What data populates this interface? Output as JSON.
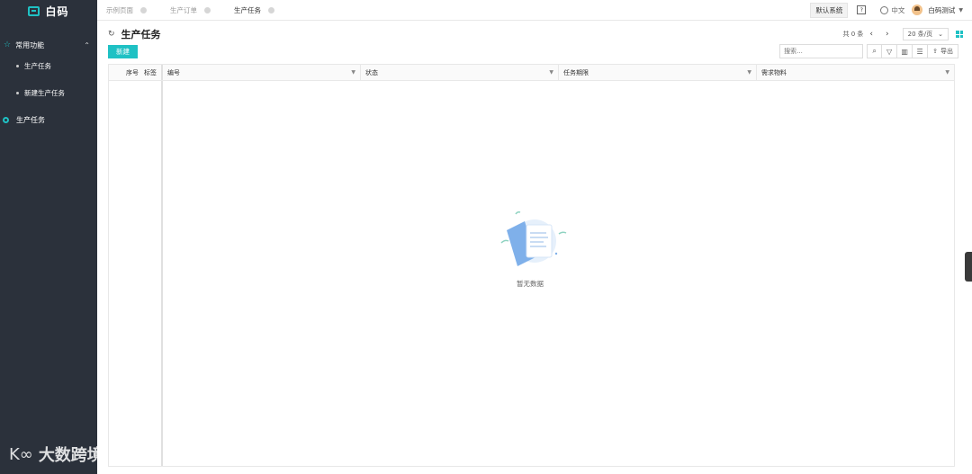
{
  "app": {
    "logo_text": "白码"
  },
  "sidebar": {
    "group_label": "常用功能",
    "group_icon": "star-icon",
    "sub_items": [
      {
        "label": "生产任务"
      },
      {
        "label": "新建生产任务"
      }
    ],
    "item": {
      "label": "生产任务"
    }
  },
  "topbar": {
    "tabs": [
      {
        "label": "示例页面",
        "active": false
      },
      {
        "label": "生产订单",
        "active": false
      },
      {
        "label": "生产任务",
        "active": true
      }
    ],
    "system_button": "默认系统",
    "help_icon": "?",
    "language": "中文",
    "username": "白码测试"
  },
  "page": {
    "title": "生产任务",
    "pager": {
      "total_label": "共 0 条",
      "page_size": "20 条/页"
    },
    "new_button": "新建",
    "search": {
      "placeholder": "搜索..."
    },
    "export_label": "导出",
    "table": {
      "fixed_headers": [
        "序号",
        "标签"
      ],
      "columns": [
        "编号",
        "状态",
        "任务期限",
        "需求物料"
      ]
    },
    "empty_text": "暂无数据"
  },
  "watermark": {
    "text": "大数跨境"
  },
  "colors": {
    "accent": "#1fc1c4",
    "sidebar_bg": "#2b313b"
  }
}
